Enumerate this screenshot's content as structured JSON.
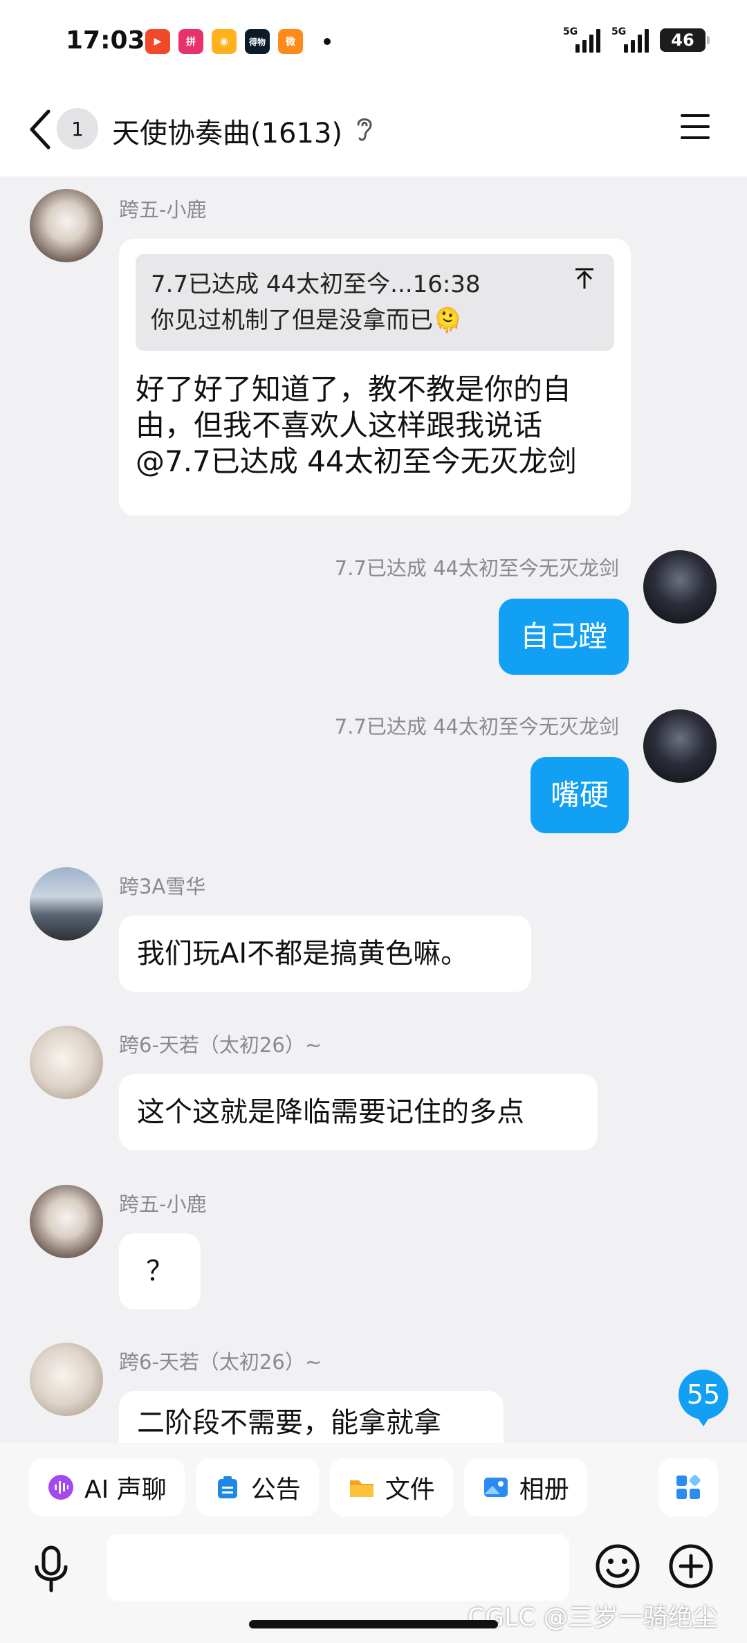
{
  "status_bar": {
    "time": "17:03",
    "app_icons": [
      {
        "name": "video-app-icon",
        "label": "▶",
        "color": "#f04a2a"
      },
      {
        "name": "pinduoduo-icon",
        "label": "拼",
        "color": "#e8336a"
      },
      {
        "name": "shop-app-icon",
        "label": "◉",
        "color": "#ffb21e"
      },
      {
        "name": "dewu-icon",
        "label": "得物",
        "color": "#0c1b2a"
      },
      {
        "name": "weibo-icon",
        "label": "微",
        "color": "#ff8a1c"
      }
    ],
    "signal_1": "5G",
    "signal_2": "5G",
    "battery": "46"
  },
  "header": {
    "unread_count": "1",
    "title": "天使协奏曲(1613)"
  },
  "messages": [
    {
      "sender": "跨五-小鹿",
      "quote_line1": "7.7已达成   44太初至今...16:38",
      "quote_line2": "你见过机制了但是没拿而已🫠",
      "text_line1": "好了好了知道了，教不教是你的自",
      "text_line2": "由，但我不喜欢人这样跟我说话",
      "text_line3": "@7.7已达成  44太初至今无灭龙剑"
    },
    {
      "sender": "7.7已达成   44太初至今无灭龙剑",
      "text": "自己蹚"
    },
    {
      "sender": "7.7已达成   44太初至今无灭龙剑",
      "text": "嘴硬"
    },
    {
      "sender": "跨3A雪华",
      "text": "我们玩AI不都是搞黄色嘛。"
    },
    {
      "sender": "跨6-天若（太初26）~",
      "text": "这个这就是降临需要记住的多点"
    },
    {
      "sender": "跨五-小鹿",
      "text": "？"
    },
    {
      "sender": "跨6-天若（太初26）~",
      "text": "二阶段不需要，能拿就拿"
    }
  ],
  "new_messages_count": "55",
  "toolbar": {
    "chips": [
      {
        "label": "AI 声聊",
        "icon": "ai-voice-icon"
      },
      {
        "label": "公告",
        "icon": "announcement-icon"
      },
      {
        "label": "文件",
        "icon": "folder-icon"
      },
      {
        "label": "相册",
        "icon": "album-icon"
      }
    ]
  },
  "watermark": "CGLC @三岁一骑绝尘"
}
